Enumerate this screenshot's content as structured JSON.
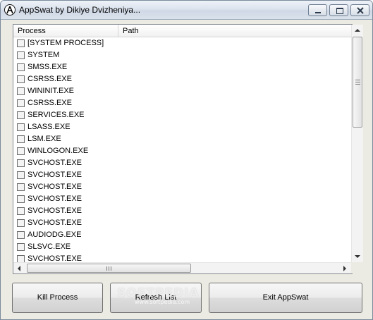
{
  "window": {
    "title": "AppSwat by Dikiye Dvizheniya...",
    "icon": "app-logo-icon"
  },
  "listview": {
    "columns": [
      "Process",
      "Path"
    ],
    "rows": [
      "[SYSTEM PROCESS]",
      "SYSTEM",
      "SMSS.EXE",
      "CSRSS.EXE",
      "WININIT.EXE",
      "CSRSS.EXE",
      "SERVICES.EXE",
      "LSASS.EXE",
      "LSM.EXE",
      "WINLOGON.EXE",
      "SVCHOST.EXE",
      "SVCHOST.EXE",
      "SVCHOST.EXE",
      "SVCHOST.EXE",
      "SVCHOST.EXE",
      "SVCHOST.EXE",
      "AUDIODG.EXE",
      "SLSVC.EXE",
      "SVCHOST.EXE"
    ]
  },
  "buttons": {
    "kill": "Kill Process",
    "refresh": "Refresh List",
    "exit": "Exit AppSwat"
  },
  "watermark": {
    "brand": "SOFTPEDIA",
    "url": "www.softpedia.com"
  }
}
